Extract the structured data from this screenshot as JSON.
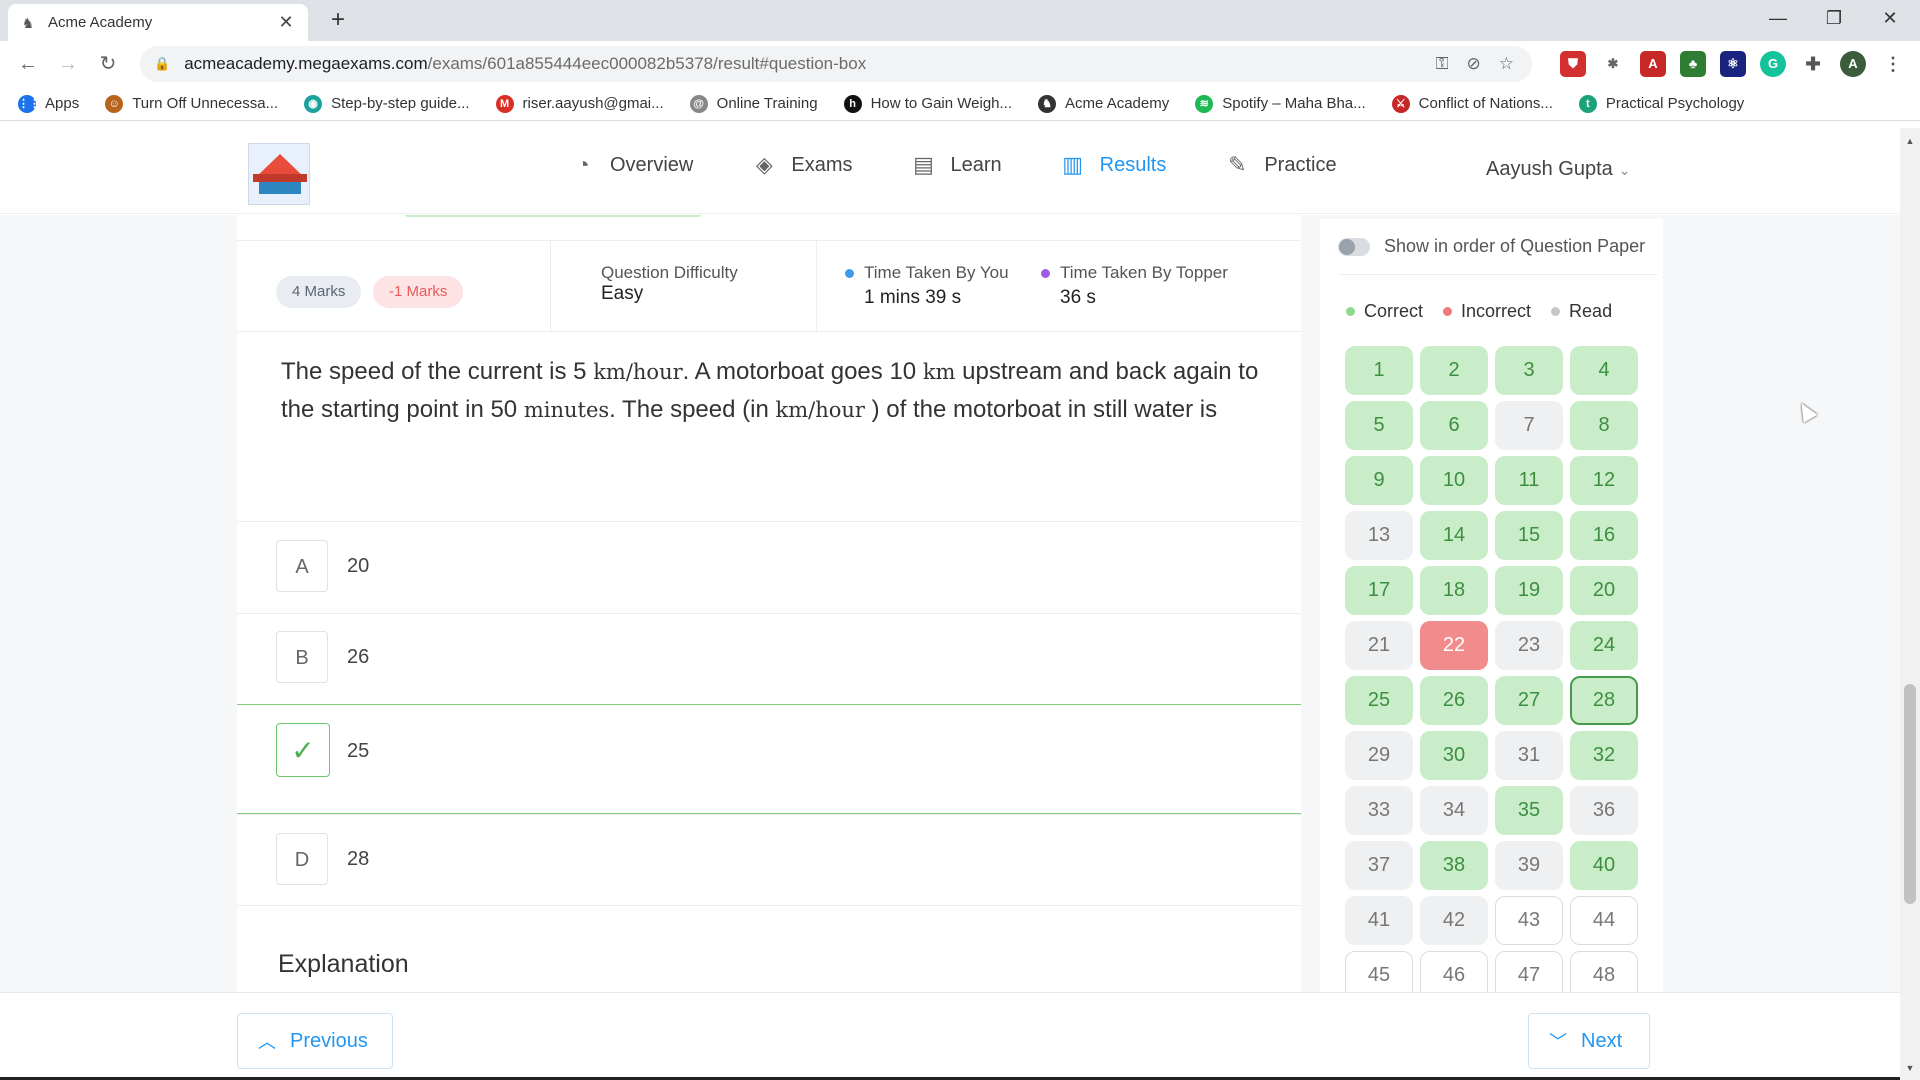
{
  "browser": {
    "tab_title": "Acme Academy",
    "tab_close": "✕",
    "new_tab": "+",
    "url_host": "acmeacademy.megaexams.com",
    "url_path": "/exams/601a855444eec000082b5378/result#question-box",
    "window": {
      "minimize": "—",
      "restore": "❐",
      "close": "✕"
    },
    "bookmarks": [
      {
        "label": "Apps",
        "icon": "apps-grid-icon",
        "color": "#1a73e8"
      },
      {
        "label": "Turn Off Unnecessa...",
        "icon": "person-avatar-icon",
        "color": "#b5651d"
      },
      {
        "label": "Step-by-step guide...",
        "icon": "eye-icon",
        "color": "#1aa39a"
      },
      {
        "label": "riser.aayush@gmai...",
        "icon": "gmail-icon",
        "color": "#d93025"
      },
      {
        "label": "Online Training",
        "icon": "spiral-icon",
        "color": "#888888"
      },
      {
        "label": "How to Gain Weigh...",
        "icon": "bold-h-icon",
        "color": "#111111"
      },
      {
        "label": "Acme Academy",
        "icon": "academy-icon",
        "color": "#333333"
      },
      {
        "label": "Spotify – Maha Bha...",
        "icon": "spotify-icon",
        "color": "#1db954"
      },
      {
        "label": "Conflict of Nations...",
        "icon": "con-icon",
        "color": "#c62828"
      },
      {
        "label": "Practical Psychology",
        "icon": "t-circle-icon",
        "color": "#1aa37a"
      }
    ]
  },
  "header": {
    "nav": [
      {
        "label": "Overview",
        "icon": "speedometer-icon",
        "active": false
      },
      {
        "label": "Exams",
        "icon": "layers-icon",
        "active": false
      },
      {
        "label": "Learn",
        "icon": "play-document-icon",
        "active": false
      },
      {
        "label": "Results",
        "icon": "bar-chart-icon",
        "active": true
      },
      {
        "label": "Practice",
        "icon": "edit-pencil-icon",
        "active": false
      }
    ],
    "user_name": "Aayush Gupta"
  },
  "question": {
    "positive_marks": "4 Marks",
    "negative_marks": "-1 Marks",
    "difficulty_label": "Question Difficulty",
    "difficulty_value": "Easy",
    "time_you_label": "Time Taken By You",
    "time_you_value": "1 mins 39 s",
    "time_topper_label": "Time Taken By Topper",
    "time_topper_value": "36 s",
    "text_parts": [
      "The speed of the current is 5 ",
      "km/hour",
      ". A motorboat goes 10 ",
      "km",
      " upstream and back again to the starting point in 50 ",
      "minutes",
      ". The speed (in ",
      "km/hour",
      " ) of the motorboat in still water is"
    ],
    "options": [
      {
        "label": "A",
        "value": "20",
        "state": "normal"
      },
      {
        "label": "B",
        "value": "26",
        "state": "normal"
      },
      {
        "label": "✓",
        "value": "25",
        "state": "correct"
      },
      {
        "label": "D",
        "value": "28",
        "state": "normal"
      }
    ],
    "explanation_heading": "Explanation"
  },
  "sidebar": {
    "toggle_label": "Show in order of Question Paper",
    "legend": [
      {
        "label": "Correct",
        "color": "#8fd88f"
      },
      {
        "label": "Incorrect",
        "color": "#f07a7a"
      },
      {
        "label": "Read",
        "color": "#c4c8cc"
      }
    ],
    "current_question": 28,
    "questions": [
      {
        "n": "1",
        "s": "correct"
      },
      {
        "n": "2",
        "s": "correct"
      },
      {
        "n": "3",
        "s": "correct"
      },
      {
        "n": "4",
        "s": "correct"
      },
      {
        "n": "5",
        "s": "correct"
      },
      {
        "n": "6",
        "s": "correct"
      },
      {
        "n": "7",
        "s": "read"
      },
      {
        "n": "8",
        "s": "correct"
      },
      {
        "n": "9",
        "s": "correct"
      },
      {
        "n": "10",
        "s": "correct"
      },
      {
        "n": "11",
        "s": "correct"
      },
      {
        "n": "12",
        "s": "correct"
      },
      {
        "n": "13",
        "s": "read"
      },
      {
        "n": "14",
        "s": "correct"
      },
      {
        "n": "15",
        "s": "correct"
      },
      {
        "n": "16",
        "s": "correct"
      },
      {
        "n": "17",
        "s": "correct"
      },
      {
        "n": "18",
        "s": "correct"
      },
      {
        "n": "19",
        "s": "correct"
      },
      {
        "n": "20",
        "s": "correct"
      },
      {
        "n": "21",
        "s": "read"
      },
      {
        "n": "22",
        "s": "incorrect"
      },
      {
        "n": "23",
        "s": "read"
      },
      {
        "n": "24",
        "s": "correct"
      },
      {
        "n": "25",
        "s": "correct"
      },
      {
        "n": "26",
        "s": "correct"
      },
      {
        "n": "27",
        "s": "correct"
      },
      {
        "n": "28",
        "s": "correct"
      },
      {
        "n": "29",
        "s": "read"
      },
      {
        "n": "30",
        "s": "correct"
      },
      {
        "n": "31",
        "s": "read"
      },
      {
        "n": "32",
        "s": "correct"
      },
      {
        "n": "33",
        "s": "read"
      },
      {
        "n": "34",
        "s": "read"
      },
      {
        "n": "35",
        "s": "correct"
      },
      {
        "n": "36",
        "s": "read"
      },
      {
        "n": "37",
        "s": "read"
      },
      {
        "n": "38",
        "s": "correct"
      },
      {
        "n": "39",
        "s": "read"
      },
      {
        "n": "40",
        "s": "correct"
      },
      {
        "n": "41",
        "s": "read"
      },
      {
        "n": "42",
        "s": "read"
      },
      {
        "n": "43",
        "s": "unseen"
      },
      {
        "n": "44",
        "s": "unseen"
      },
      {
        "n": "45",
        "s": "unseen"
      },
      {
        "n": "46",
        "s": "unseen"
      },
      {
        "n": "47",
        "s": "unseen"
      },
      {
        "n": "48",
        "s": "unseen"
      }
    ]
  },
  "footer": {
    "previous_label": "Previous",
    "next_label": "Next"
  }
}
